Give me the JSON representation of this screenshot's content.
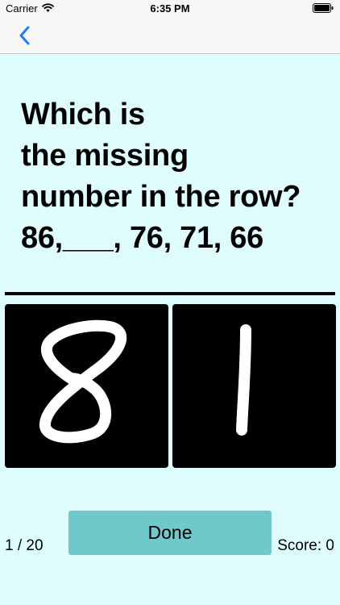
{
  "status_bar": {
    "carrier": "Carrier",
    "time": "6:35 PM"
  },
  "nav": {
    "back_icon": "chevron-left-icon",
    "accent_color": "#1a7ef5"
  },
  "question": {
    "lines": [
      "Which is",
      "the missing",
      "number in the row?",
      "86,___, 76, 71, 66"
    ]
  },
  "pads": [
    {
      "name": "digit-pad-tens",
      "drawn_digit": "8"
    },
    {
      "name": "digit-pad-ones",
      "drawn_digit": "1"
    }
  ],
  "footer": {
    "done_label": "Done",
    "progress": "1 / 20",
    "score": "Score: 0"
  },
  "colors": {
    "background": "#dffdfd",
    "done_button": "#71c8cb",
    "pad": "#000000",
    "stroke": "#ffffff"
  }
}
